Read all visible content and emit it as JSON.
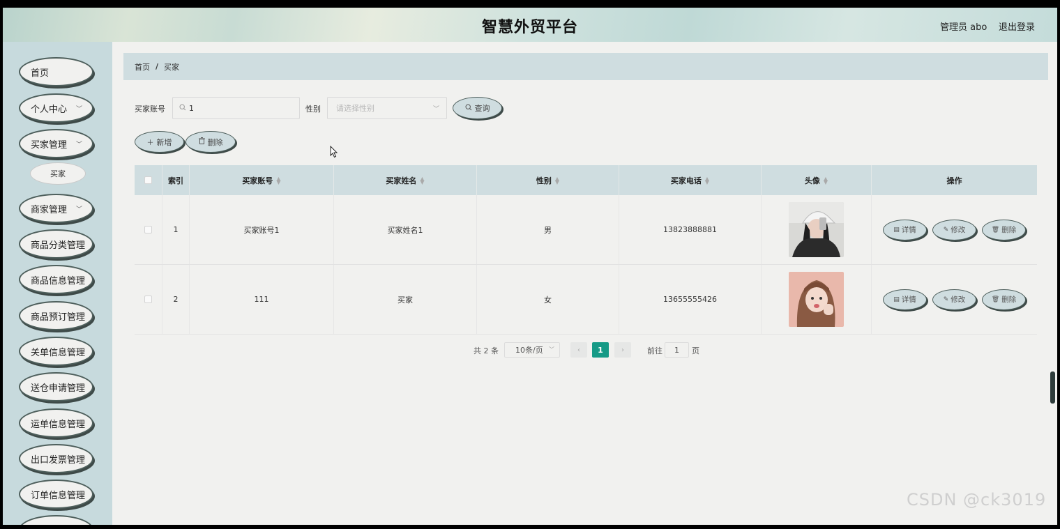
{
  "header": {
    "title": "智慧外贸平台",
    "admin": "管理员 abo",
    "logout": "退出登录"
  },
  "sidebar": {
    "items": [
      {
        "label": "首页",
        "has_chevron": false
      },
      {
        "label": "个人中心",
        "has_chevron": true
      },
      {
        "label": "买家管理",
        "has_chevron": true
      },
      {
        "label": "商家管理",
        "has_chevron": true
      },
      {
        "label": "商品分类管理",
        "has_chevron": false
      },
      {
        "label": "商品信息管理",
        "has_chevron": false
      },
      {
        "label": "商品预订管理",
        "has_chevron": false
      },
      {
        "label": "关单信息管理",
        "has_chevron": false
      },
      {
        "label": "送仓申请管理",
        "has_chevron": false
      },
      {
        "label": "运单信息管理",
        "has_chevron": false
      },
      {
        "label": "出口发票管理",
        "has_chevron": false
      },
      {
        "label": "订单信息管理",
        "has_chevron": false
      }
    ],
    "subitem": "买家"
  },
  "breadcrumb": {
    "home": "首页",
    "sep": "/",
    "current": "买家"
  },
  "search": {
    "account_label": "买家账号",
    "account_value": "1",
    "gender_label": "性别",
    "gender_placeholder": "请选择性别",
    "query_button": "查询"
  },
  "actions": {
    "add": "新增",
    "delete": "删除"
  },
  "table": {
    "headers": [
      "索引",
      "买家账号",
      "买家姓名",
      "性别",
      "买家电话",
      "头像",
      "操作"
    ],
    "rows": [
      {
        "index": "1",
        "account": "买家账号1",
        "name": "买家姓名1",
        "gender": "男",
        "phone": "13823888881"
      },
      {
        "index": "2",
        "account": "111",
        "name": "买家",
        "gender": "女",
        "phone": "13655555426"
      }
    ],
    "row_actions": {
      "detail": "详情",
      "edit": "修改",
      "delete": "删除"
    }
  },
  "pagination": {
    "total": "共 2 条",
    "page_size": "10条/页",
    "current_page": "1",
    "goto_prefix": "前往",
    "goto_value": "1",
    "goto_suffix": "页"
  },
  "watermark": "CSDN @ck3019",
  "colors": {
    "accent": "#159a86",
    "panel": "#cfdde0",
    "sidebar": "#c7dadd",
    "background": "#f1f1ef"
  },
  "icons": [
    "search-icon",
    "chevron-down-icon",
    "plus-icon",
    "trash-icon",
    "document-icon",
    "edit-icon",
    "mouse-cursor-icon"
  ]
}
